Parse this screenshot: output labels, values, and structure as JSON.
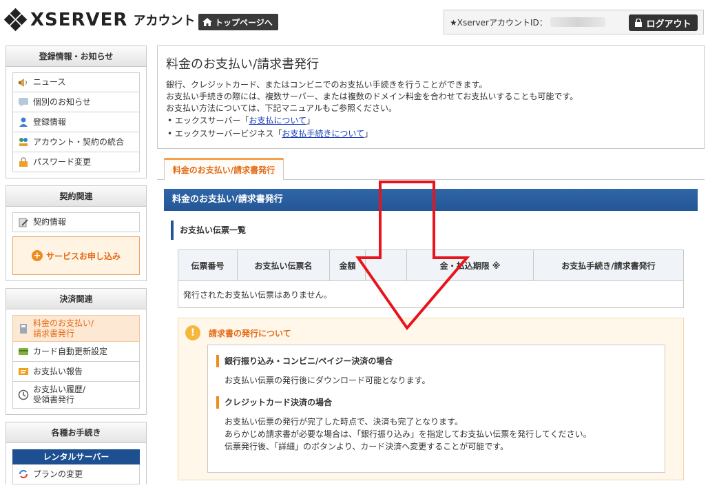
{
  "header": {
    "logo_text": "XSERVER",
    "logo_sub": "アカウント",
    "top_button": "トップページへ",
    "account_label": "★XserverアカウントID：",
    "logout_button": "ログアウト"
  },
  "sidebar": {
    "section1": {
      "title": "登録情報・お知らせ",
      "items": [
        {
          "label": "ニュース",
          "icon": "megaphone-icon"
        },
        {
          "label": "個別のお知らせ",
          "icon": "message-icon"
        },
        {
          "label": "登録情報",
          "icon": "user-icon"
        },
        {
          "label": "アカウント・契約の統合",
          "icon": "merge-icon"
        },
        {
          "label": "パスワード変更",
          "icon": "lock-icon"
        }
      ]
    },
    "section2": {
      "title": "契約関連",
      "items": [
        {
          "label": "契約情報",
          "icon": "contract-icon"
        }
      ],
      "service_button": "サービスお申し込み"
    },
    "section3": {
      "title": "決済関連",
      "items": [
        {
          "label_line1": "料金のお支払い/",
          "label_line2": "請求書発行",
          "icon": "calculator-icon"
        },
        {
          "label": "カード自動更新設定",
          "icon": "card-icon"
        },
        {
          "label": "お支払い報告",
          "icon": "report-icon"
        },
        {
          "label_line1": "お支払い履歴/",
          "label_line2": "受領書発行",
          "icon": "clock-icon"
        }
      ]
    },
    "section4": {
      "title": "各種お手続き",
      "sub_title": "レンタルサーバー",
      "items": [
        {
          "label": "プランの変更",
          "icon": "refresh-icon"
        }
      ]
    }
  },
  "intro": {
    "title": "料金のお支払い/請求書発行",
    "line1": "銀行、クレジットカード、またはコンビニでのお支払い手続きを行うことができます。",
    "line2": "お支払い手続きの際には、複数サーバー、または複数のドメイン料金を合わせてお支払いすることも可能です。",
    "line3": "お支払い方法については、下記マニュアルもご参照ください。",
    "bullet1_prefix": "• エックスサーバー「",
    "bullet1_link": "お支払について",
    "bullet1_suffix": "」",
    "bullet2_prefix": "• エックスサーバービジネス「",
    "bullet2_link": "お支払手続きについて",
    "bullet2_suffix": "」"
  },
  "tab": {
    "label": "料金のお支払い/請求書発行"
  },
  "main": {
    "bar_title": "料金のお支払い/請求書発行",
    "section_title": "お支払い伝票一覧",
    "table": {
      "headers": [
        "伝票番号",
        "お支払い伝票名",
        "金額",
        "",
        "金・払込期限 ※",
        "お支払手続き/請求書発行"
      ],
      "empty_message": "発行されたお支払い伝票はありません。"
    },
    "notice": {
      "title": "請求書の発行について",
      "block1_title": "銀行振り込み・コンビニ/ペイジー決済の場合",
      "block1_text": "お支払い伝票の発行後にダウンロード可能となります。",
      "block2_title": "クレジットカード決済の場合",
      "block2_line1": "お支払い伝票の発行が完了した時点で、決済も完了となります。",
      "block2_line2": "あらかじめ請求書が必要な場合は、「銀行振り込み」を指定してお支払い伝票を発行してください。",
      "block2_line3": "伝票発行後、「詳細」のボタンより、カード決済へ変更することが可能です。"
    }
  },
  "colors": {
    "accent_blue": "#245695",
    "accent_orange": "#e36b16",
    "arrow_red": "#e8141c"
  }
}
